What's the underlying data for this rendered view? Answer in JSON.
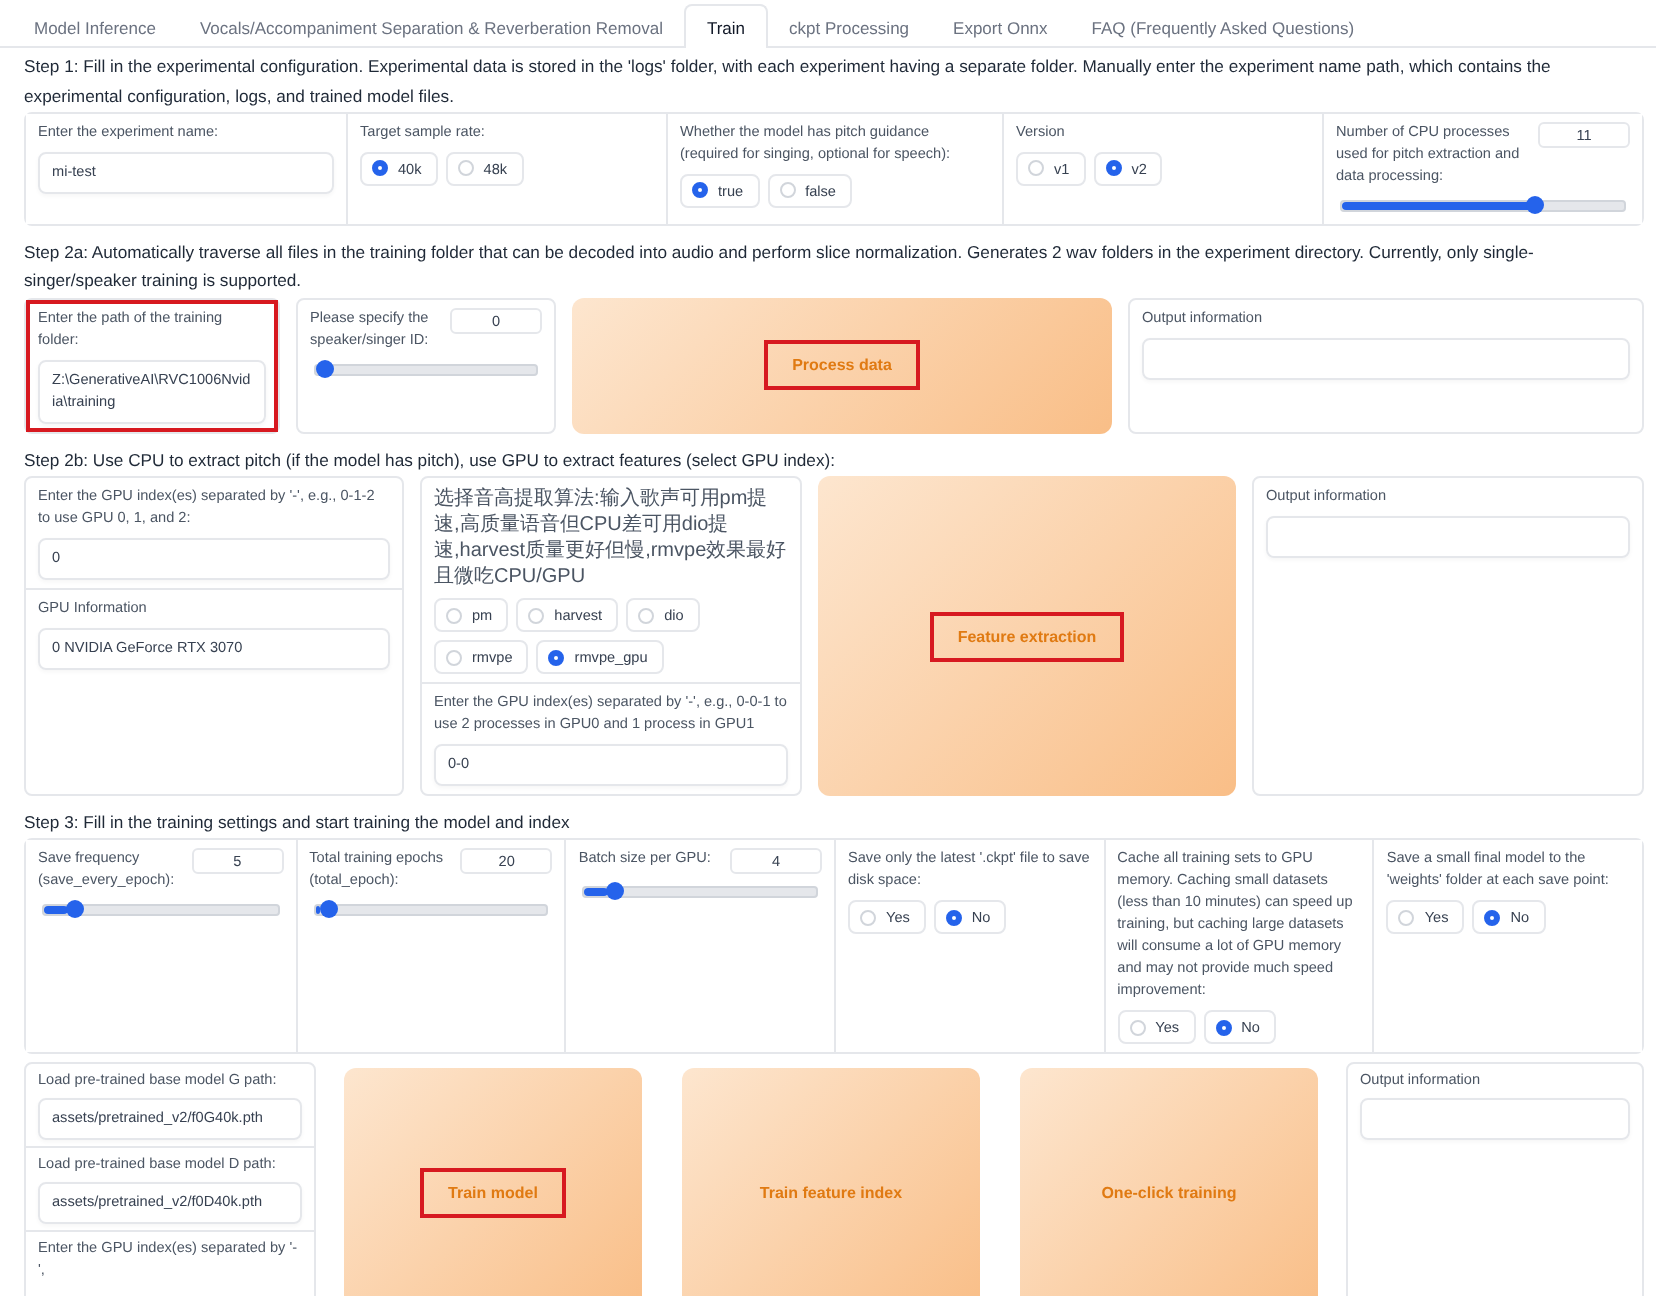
{
  "tabs": [
    {
      "label": "Model Inference",
      "selected": false
    },
    {
      "label": "Vocals/Accompaniment Separation & Reverberation Removal",
      "selected": false
    },
    {
      "label": "Train",
      "selected": true
    },
    {
      "label": "ckpt Processing",
      "selected": false
    },
    {
      "label": "Export Onnx",
      "selected": false
    },
    {
      "label": "FAQ (Frequently Asked Questions)",
      "selected": false
    }
  ],
  "sections": [
    {
      "text": "Step 1: Fill in the experimental configuration. Experimental data is stored in the 'logs' folder, with each experiment having a separate folder. Manually enter the experiment name path, which contains the experimental configuration, logs, and trained model files.",
      "cells": [
        {
          "blocks": [
            {
              "kind": "text",
              "label": "Enter the experiment name:",
              "value": "mi-test"
            }
          ]
        },
        {
          "blocks": [
            {
              "kind": "radio",
              "label": "Target sample rate:",
              "options": [
                {
                  "label": "40k",
                  "selected": true
                },
                {
                  "label": "48k",
                  "selected": false
                }
              ]
            }
          ]
        },
        {
          "blocks": [
            {
              "kind": "radio",
              "label": "Whether the model has pitch guidance (required for singing, optional for speech):",
              "options": [
                {
                  "label": "true",
                  "selected": true
                },
                {
                  "label": "false",
                  "selected": false
                }
              ]
            }
          ]
        },
        {
          "blocks": [
            {
              "kind": "radio",
              "label": "Version",
              "options": [
                {
                  "label": "v1",
                  "selected": false
                },
                {
                  "label": "v2",
                  "selected": true
                }
              ]
            }
          ]
        },
        {
          "blocks": [
            {
              "kind": "slider",
              "label": "Number of CPU processes used for pitch extraction and data processing:",
              "value": "11",
              "level": 0.7
            }
          ]
        }
      ]
    },
    {
      "text": "Step 2a: Automatically traverse all files in the training folder that can be decoded into audio and perform slice normalization. Generates 2 wav folders in the experiment directory. Currently, only single-singer/speaker training is supported.",
      "cells": [
        {
          "blocks": [
            {
              "kind": "text",
              "label": "Enter the path of the training folder:",
              "value": "Z:\\GenerativeAI\\RVC1006Nvidia\\training",
              "highlighted": true
            }
          ]
        },
        {
          "blocks": [
            {
              "kind": "slider",
              "label": "Please specify the speaker/singer ID:",
              "value": "0",
              "level": 0
            }
          ]
        },
        {
          "blocks": [
            {
              "kind": "button",
              "label": "Process data",
              "highlighted": true
            }
          ]
        },
        {
          "blocks": [
            {
              "kind": "output",
              "label": "Output information"
            }
          ]
        }
      ]
    },
    {
      "text": "Step 2b: Use CPU to extract pitch (if the model has pitch), use GPU to extract features (select GPU index):",
      "cells": [
        {
          "blocks": [
            {
              "kind": "text",
              "label": "Enter the GPU index(es) separated by '-', e.g., 0-1-2 to use GPU 0, 1, and 2:",
              "value": "0"
            },
            {
              "kind": "text",
              "label": "GPU Information",
              "value": "0 NVIDIA GeForce RTX 3070"
            }
          ]
        },
        {
          "blocks": [
            {
              "kind": "radio",
              "label": "选择音高提取算法:输入歌声可用pm提速,高质量语音但CPU差可用dio提速,harvest质量更好但慢,rmvpe效果最好且微吃CPU/GPU",
              "options": [
                {
                  "label": "pm",
                  "selected": false
                },
                {
                  "label": "harvest",
                  "selected": false
                },
                {
                  "label": "dio",
                  "selected": false
                },
                {
                  "label": "rmvpe",
                  "selected": false
                },
                {
                  "label": "rmvpe_gpu",
                  "selected": true
                }
              ]
            },
            {
              "kind": "text",
              "label": "Enter the GPU index(es) separated by '-', e.g., 0-0-1 to use 2 processes in GPU0 and 1 process in GPU1",
              "value": "0-0"
            }
          ]
        },
        {
          "blocks": [
            {
              "kind": "button",
              "label": "Feature extraction",
              "highlighted": true
            }
          ]
        },
        {
          "blocks": [
            {
              "kind": "output",
              "label": "Output information"
            }
          ]
        }
      ]
    },
    {
      "text": "Step 3: Fill in the training settings and start training the model and index",
      "cells": [
        {
          "blocks": [
            {
              "kind": "slider",
              "label": "Save frequency (save_every_epoch):",
              "value": "5",
              "level": 0.1
            }
          ]
        },
        {
          "blocks": [
            {
              "kind": "slider",
              "label": "Total training epochs (total_epoch):",
              "value": "20",
              "level": 0.02
            }
          ]
        },
        {
          "blocks": [
            {
              "kind": "slider",
              "label": "Batch size per GPU:",
              "value": "4",
              "level": 0.1
            }
          ]
        },
        {
          "blocks": [
            {
              "kind": "radio",
              "label": "Save only the latest '.ckpt' file to save disk space:",
              "options": [
                {
                  "label": "Yes",
                  "selected": false
                },
                {
                  "label": "No",
                  "selected": true
                }
              ]
            }
          ]
        },
        {
          "blocks": [
            {
              "kind": "radio",
              "label": "Cache all training sets to GPU memory. Caching small datasets (less than 10 minutes) can speed up training, but caching large datasets will consume a lot of GPU memory and may not provide much speed improvement:",
              "options": [
                {
                  "label": "Yes",
                  "selected": false
                },
                {
                  "label": "No",
                  "selected": true
                }
              ]
            }
          ]
        },
        {
          "blocks": [
            {
              "kind": "radio",
              "label": "Save a small final model to the 'weights' folder at each save point:",
              "options": [
                {
                  "label": "Yes",
                  "selected": false
                },
                {
                  "label": "No",
                  "selected": true
                }
              ]
            }
          ]
        }
      ]
    },
    {
      "cells": [
        {
          "blocks": [
            {
              "kind": "text",
              "label": "Load pre-trained base model G path:",
              "value": "assets/pretrained_v2/f0G40k.pth"
            },
            {
              "kind": "text",
              "label": "Load pre-trained base model D path:",
              "value": "assets/pretrained_v2/f0D40k.pth"
            },
            {
              "kind": "note",
              "label": "Enter the GPU index(es) separated by '-',"
            }
          ]
        },
        {
          "blocks": [
            {
              "kind": "button",
              "label": "Train model",
              "highlighted": true
            }
          ]
        },
        {
          "blocks": [
            {
              "kind": "button",
              "label": "Train feature index",
              "highlighted": false
            }
          ]
        },
        {
          "blocks": [
            {
              "kind": "button",
              "label": "One-click training",
              "highlighted": false
            }
          ]
        },
        {
          "blocks": [
            {
              "kind": "output",
              "label": "Output information"
            }
          ]
        }
      ]
    }
  ]
}
